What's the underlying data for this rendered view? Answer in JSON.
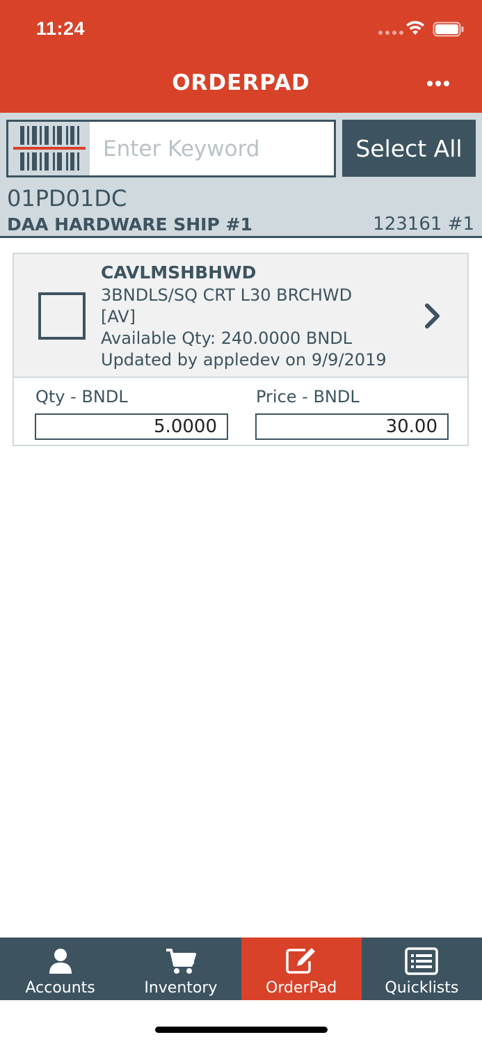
{
  "status_bar": {
    "time": "11:24"
  },
  "header": {
    "title": "ORDERPAD",
    "more_icon": "more-horizontal-icon"
  },
  "search": {
    "placeholder": "Enter Keyword",
    "value": "",
    "barcode_icon": "barcode-scan-icon",
    "select_all_label": "Select All"
  },
  "account": {
    "code": "01PD01DC",
    "name": "DAA HARDWARE SHIP #1",
    "number": "123161 #1"
  },
  "items": [
    {
      "code": "CAVLMSHBHWD",
      "description_line1": "3BNDLS/SQ CRT L30  BRCHWD",
      "description_line2": "[AV]",
      "available": "Available Qty: 240.0000 BNDL",
      "updated": "Updated by appledev on 9/9/2019",
      "checked": false,
      "qty_label": "Qty - BNDL",
      "qty_value": "5.0000",
      "price_label": "Price - BNDL",
      "price_value": "30.00"
    }
  ],
  "tabs": [
    {
      "label": "Accounts",
      "icon": "person-icon",
      "active": false
    },
    {
      "label": "Inventory",
      "icon": "cart-icon",
      "active": false
    },
    {
      "label": "OrderPad",
      "icon": "edit-pencil-icon",
      "active": true
    },
    {
      "label": "Quicklists",
      "icon": "list-icon",
      "active": false
    }
  ],
  "colors": {
    "brand_red": "#d84229",
    "slate": "#3d5460",
    "panel_gray": "#cfd9de",
    "card_gray": "#f1f1f1"
  }
}
